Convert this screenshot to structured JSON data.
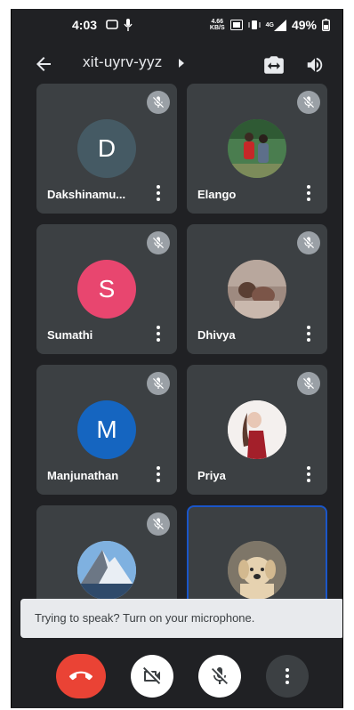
{
  "status_bar": {
    "time": "4:03",
    "net_speed_top": "4.66",
    "net_speed_bottom": "KB/S",
    "network": "4G",
    "battery": "49%"
  },
  "top_bar": {
    "meeting_code": "xit-uyrv-yyz"
  },
  "participants": [
    {
      "name": "Dakshinamu...",
      "initial": "D",
      "avatar_color": "#455a64",
      "avatar_type": "letter"
    },
    {
      "name": "Elango",
      "initial": "",
      "avatar_color": "#3b6b45",
      "avatar_type": "photo"
    },
    {
      "name": "Sumathi",
      "initial": "S",
      "avatar_color": "#e8466f",
      "avatar_type": "letter"
    },
    {
      "name": "Dhivya",
      "initial": "",
      "avatar_color": "#8d6e63",
      "avatar_type": "photo"
    },
    {
      "name": "Manjunathan",
      "initial": "M",
      "avatar_color": "#1565c0",
      "avatar_type": "letter"
    },
    {
      "name": "Priya",
      "initial": "",
      "avatar_color": "#f1ecea",
      "avatar_type": "photo"
    },
    {
      "name": "",
      "initial": "",
      "avatar_color": "#9fc3e6",
      "avatar_type": "photo"
    },
    {
      "name": "",
      "initial": "",
      "avatar_color": "#8a8274",
      "avatar_type": "photo"
    }
  ],
  "toast": {
    "message": "Trying to speak? Turn on your microphone."
  },
  "colors": {
    "background": "#202124",
    "tile": "#3c4043",
    "end_call": "#ea4335",
    "active_border": "#1a56c9"
  }
}
